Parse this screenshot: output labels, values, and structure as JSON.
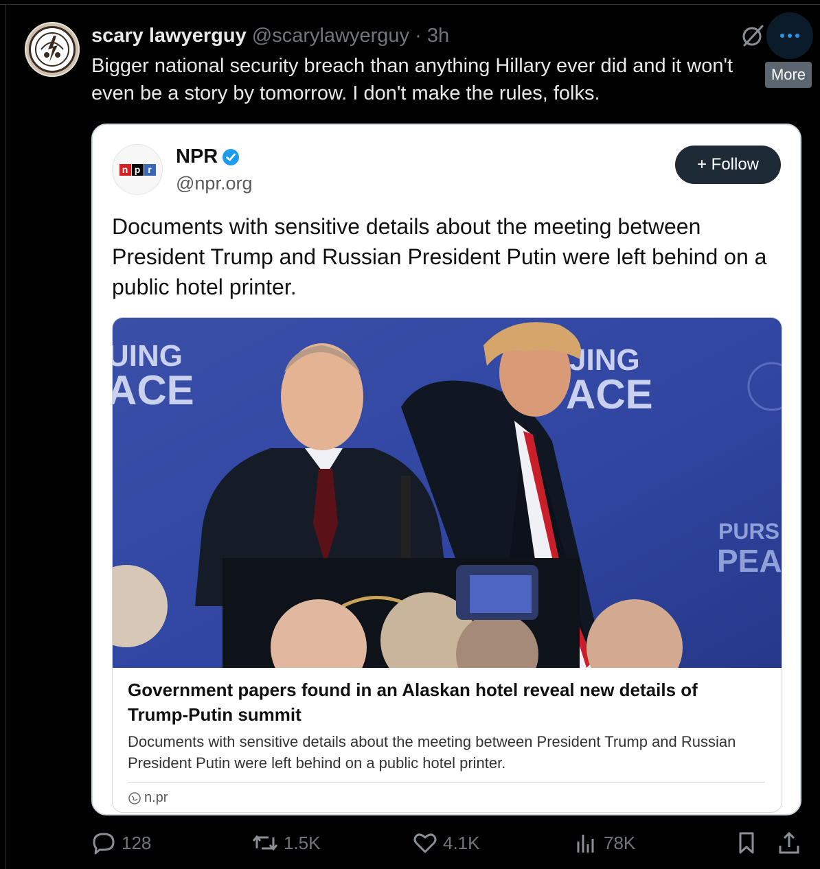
{
  "tweet": {
    "author_name": "scary lawyerguy",
    "author_handle": "@scarylawyerguy",
    "separator": "·",
    "time": "3h",
    "text": "Bigger national security breach than anything Hillary ever did and it won't even be a story by tomorrow. I don't make the rules, folks.",
    "more_tooltip": "More",
    "avatar_icon": "steal-your-face-icon"
  },
  "quoted": {
    "name": "NPR",
    "handle": "@npr.org",
    "verified": true,
    "follow_label": "+ Follow",
    "logo_letters": [
      "n",
      "p",
      "r"
    ],
    "logo_colors": [
      "#d62021",
      "#000000",
      "#3a68b3"
    ],
    "text": "Documents with sensitive details about the meeting between President Trump and Russian President Putin were left behind on a public hotel printer.",
    "article": {
      "backdrop_text_left": [
        "UING",
        "ACE"
      ],
      "backdrop_text_right": [
        "JING",
        "ACE"
      ],
      "backdrop_text_far_right": [
        "PURS",
        "PEA"
      ],
      "title": "Government papers found in an Alaskan hotel reveal new details of Trump-Putin summit",
      "description": "Documents with sensitive details about the meeting between President Trump and Russian President Putin were left behind on a public hotel printer.",
      "domain": "n.pr"
    }
  },
  "actions": {
    "replies": "128",
    "reposts": "1.5K",
    "likes": "4.1K",
    "views": "78K"
  },
  "colors": {
    "background": "#000000",
    "text": "#e7e9ea",
    "muted": "#71767b",
    "verified": "#1d9bf0",
    "follow_bg": "#1e2a35"
  }
}
